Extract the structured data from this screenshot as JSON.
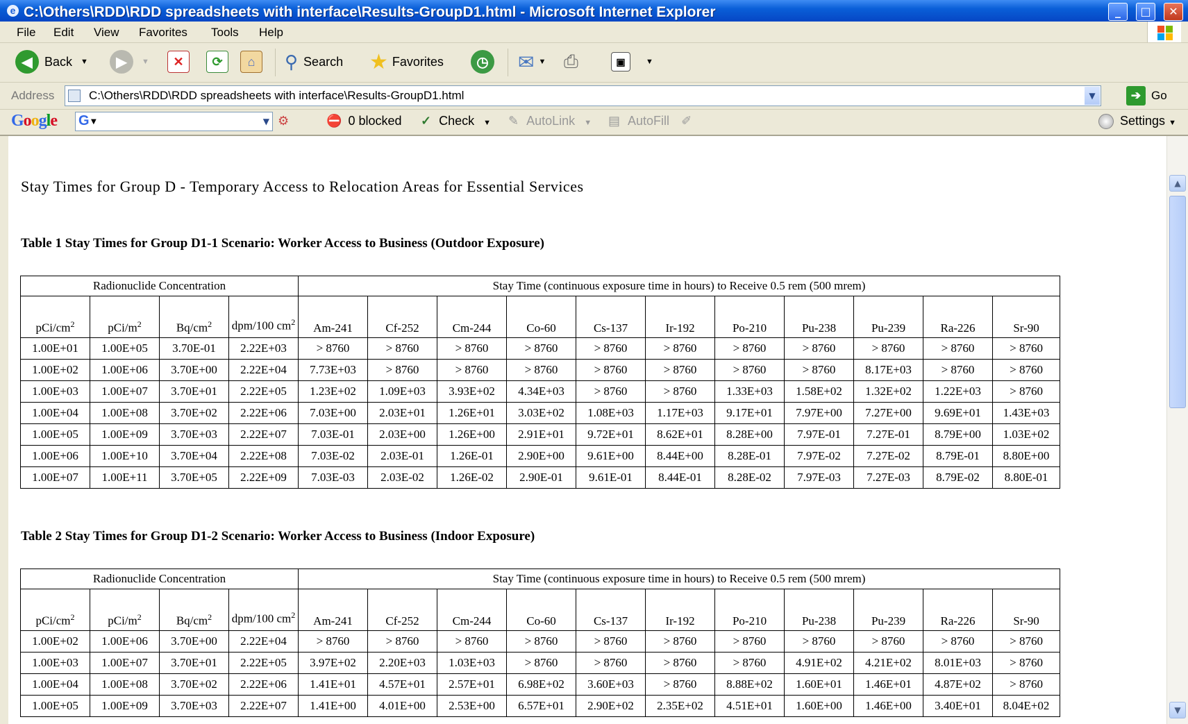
{
  "window": {
    "title": "C:\\Others\\RDD\\RDD spreadsheets with interface\\Results-GroupD1.html - Microsoft Internet Explorer"
  },
  "menu": [
    "File",
    "Edit",
    "View",
    "Favorites",
    "Tools",
    "Help"
  ],
  "toolbar": {
    "back": "Back",
    "search": "Search",
    "favorites": "Favorites"
  },
  "address": {
    "label": "Address",
    "value": "C:\\Others\\RDD\\RDD spreadsheets with interface\\Results-GroupD1.html",
    "go": "Go"
  },
  "google": {
    "logo": "Google",
    "blocked": "0 blocked",
    "check": "Check",
    "autolink": "AutoLink",
    "autofill": "AutoFill",
    "settings": "Settings"
  },
  "page": {
    "heading": "Stay Times for Group D - Temporary Access to Relocation Areas for Essential Services",
    "concentration_header": "Radionuclide Concentration",
    "staytime_header": "Stay Time (continuous exposure time in hours) to Receive 0.5 rem (500 mrem)",
    "units": [
      "pCi/cm",
      "pCi/m",
      "Bq/cm",
      "dpm/100 cm"
    ],
    "unit_sups": [
      "2",
      "2",
      "2",
      "2"
    ],
    "nuclides": [
      "Am-241",
      "Cf-252",
      "Cm-244",
      "Co-60",
      "Cs-137",
      "Ir-192",
      "Po-210",
      "Pu-238",
      "Pu-239",
      "Ra-226",
      "Sr-90"
    ],
    "tables": [
      {
        "caption": "Table 1  Stay Times for Group D1-1 Scenario: Worker Access to Business (Outdoor Exposure)",
        "rows": [
          [
            "1.00E+01",
            "1.00E+05",
            "3.70E-01",
            "2.22E+03",
            "> 8760",
            "> 8760",
            "> 8760",
            "> 8760",
            "> 8760",
            "> 8760",
            "> 8760",
            "> 8760",
            "> 8760",
            "> 8760",
            "> 8760"
          ],
          [
            "1.00E+02",
            "1.00E+06",
            "3.70E+00",
            "2.22E+04",
            "7.73E+03",
            "> 8760",
            "> 8760",
            "> 8760",
            "> 8760",
            "> 8760",
            "> 8760",
            "> 8760",
            "8.17E+03",
            "> 8760",
            "> 8760"
          ],
          [
            "1.00E+03",
            "1.00E+07",
            "3.70E+01",
            "2.22E+05",
            "1.23E+02",
            "1.09E+03",
            "3.93E+02",
            "4.34E+03",
            "> 8760",
            "> 8760",
            "1.33E+03",
            "1.58E+02",
            "1.32E+02",
            "1.22E+03",
            "> 8760"
          ],
          [
            "1.00E+04",
            "1.00E+08",
            "3.70E+02",
            "2.22E+06",
            "7.03E+00",
            "2.03E+01",
            "1.26E+01",
            "3.03E+02",
            "1.08E+03",
            "1.17E+03",
            "9.17E+01",
            "7.97E+00",
            "7.27E+00",
            "9.69E+01",
            "1.43E+03"
          ],
          [
            "1.00E+05",
            "1.00E+09",
            "3.70E+03",
            "2.22E+07",
            "7.03E-01",
            "2.03E+00",
            "1.26E+00",
            "2.91E+01",
            "9.72E+01",
            "8.62E+01",
            "8.28E+00",
            "7.97E-01",
            "7.27E-01",
            "8.79E+00",
            "1.03E+02"
          ],
          [
            "1.00E+06",
            "1.00E+10",
            "3.70E+04",
            "2.22E+08",
            "7.03E-02",
            "2.03E-01",
            "1.26E-01",
            "2.90E+00",
            "9.61E+00",
            "8.44E+00",
            "8.28E-01",
            "7.97E-02",
            "7.27E-02",
            "8.79E-01",
            "8.80E+00"
          ],
          [
            "1.00E+07",
            "1.00E+11",
            "3.70E+05",
            "2.22E+09",
            "7.03E-03",
            "2.03E-02",
            "1.26E-02",
            "2.90E-01",
            "9.61E-01",
            "8.44E-01",
            "8.28E-02",
            "7.97E-03",
            "7.27E-03",
            "8.79E-02",
            "8.80E-01"
          ]
        ]
      },
      {
        "caption": "Table 2  Stay Times for Group D1-2 Scenario: Worker Access to Business (Indoor Exposure)",
        "rows": [
          [
            "1.00E+02",
            "1.00E+06",
            "3.70E+00",
            "2.22E+04",
            "> 8760",
            "> 8760",
            "> 8760",
            "> 8760",
            "> 8760",
            "> 8760",
            "> 8760",
            "> 8760",
            "> 8760",
            "> 8760",
            "> 8760"
          ],
          [
            "1.00E+03",
            "1.00E+07",
            "3.70E+01",
            "2.22E+05",
            "3.97E+02",
            "2.20E+03",
            "1.03E+03",
            "> 8760",
            "> 8760",
            "> 8760",
            "> 8760",
            "4.91E+02",
            "4.21E+02",
            "8.01E+03",
            "> 8760"
          ],
          [
            "1.00E+04",
            "1.00E+08",
            "3.70E+02",
            "2.22E+06",
            "1.41E+01",
            "4.57E+01",
            "2.57E+01",
            "6.98E+02",
            "3.60E+03",
            "> 8760",
            "8.88E+02",
            "1.60E+01",
            "1.46E+01",
            "4.87E+02",
            "> 8760"
          ],
          [
            "1.00E+05",
            "1.00E+09",
            "3.70E+03",
            "2.22E+07",
            "1.41E+00",
            "4.01E+00",
            "2.53E+00",
            "6.57E+01",
            "2.90E+02",
            "2.35E+02",
            "4.51E+01",
            "1.60E+00",
            "1.46E+00",
            "3.40E+01",
            "8.04E+02"
          ]
        ]
      }
    ]
  }
}
